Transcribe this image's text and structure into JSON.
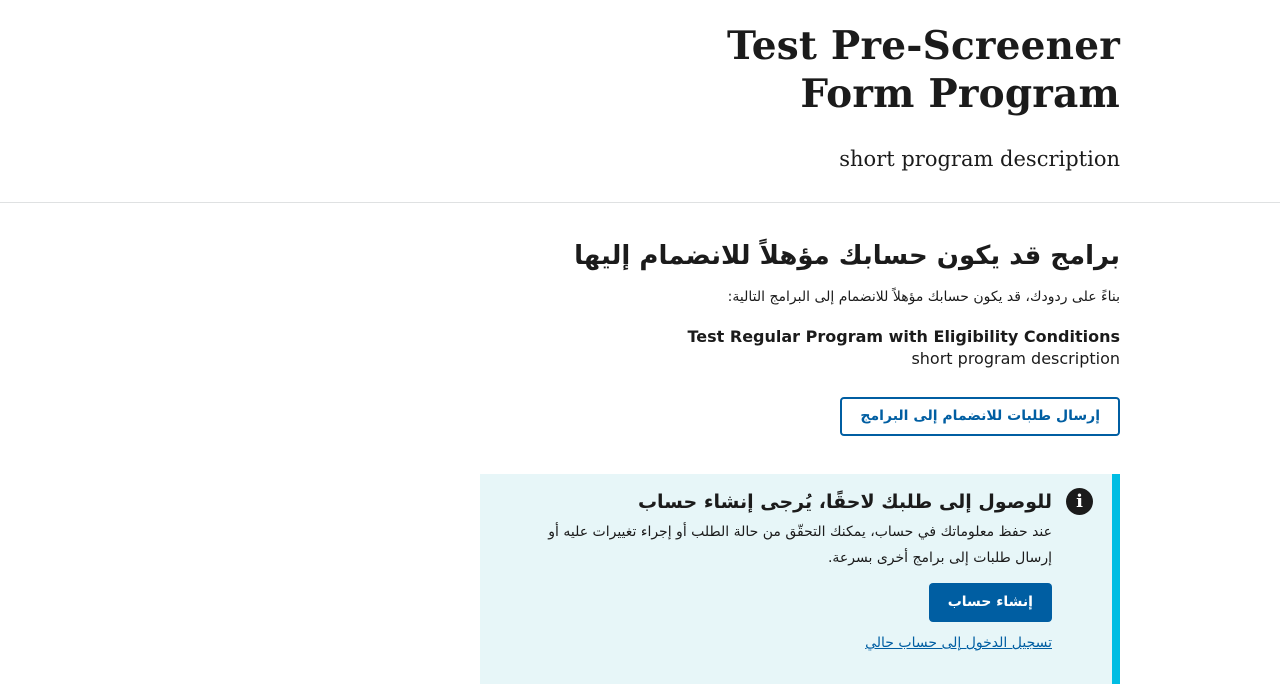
{
  "header": {
    "program_title": "Test Pre-Screener Form Program",
    "program_description": "short program description"
  },
  "results": {
    "heading": "برامج قد يكون حسابك مؤهلاً للانضمام إليها",
    "intro": "بناءً على ردودك، قد يكون حسابك مؤهلاً للانضمام إلى البرامج التالية:",
    "programs": [
      {
        "name": "Test Regular Program with Eligibility Conditions",
        "description": "short program description"
      }
    ],
    "apply_button_label": "إرسال طلبات للانضمام إلى البرامج"
  },
  "alert": {
    "icon": "info-icon",
    "icon_glyph": "i",
    "heading": "للوصول إلى طلبك لاحقًا، يُرجى إنشاء حساب",
    "text": "عند حفظ معلوماتك في حساب، يمكنك التحقّق من حالة الطلب أو إجراء تغييرات عليه أو إرسال طلبات إلى برامج أخرى بسرعة.",
    "create_account_label": "إنشاء حساب",
    "login_link_label": "تسجيل الدخول إلى حساب حالي"
  },
  "colors": {
    "primary": "#005ea2",
    "alert_background": "#e7f6f8",
    "alert_border": "#00bde3",
    "text": "#1b1b1b",
    "divider": "#dfe1e2"
  }
}
